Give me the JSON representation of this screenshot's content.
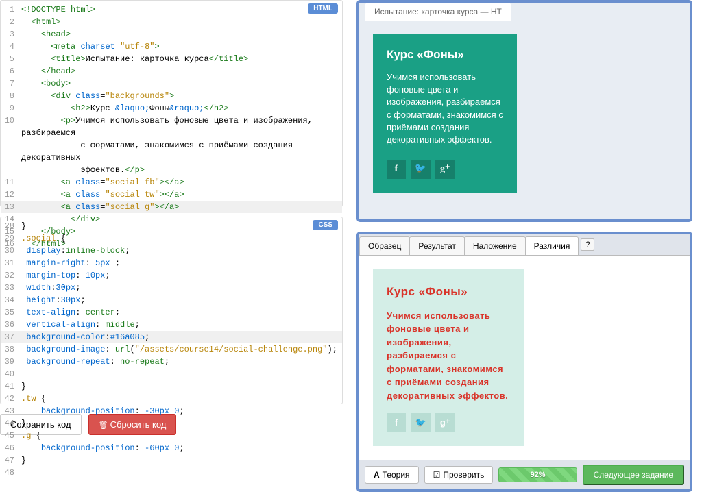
{
  "badges": {
    "html": "HTML",
    "css": "CSS"
  },
  "html_lines": [
    {
      "n": 1,
      "html": "<span class='tag'>&lt;!DOCTYPE html&gt;</span>"
    },
    {
      "n": 2,
      "html": "  <span class='tag'>&lt;html&gt;</span>"
    },
    {
      "n": 3,
      "html": "    <span class='tag'>&lt;head&gt;</span>"
    },
    {
      "n": 4,
      "html": "      <span class='tag'>&lt;meta</span> <span class='attr-name'>charset</span>=<span class='attr-val'>\"utf-8\"</span><span class='tag'>&gt;</span>"
    },
    {
      "n": 5,
      "html": "      <span class='tag'>&lt;title&gt;</span>Испытание: карточка курса<span class='tag'>&lt;/title&gt;</span>"
    },
    {
      "n": 6,
      "html": "    <span class='tag'>&lt;/head&gt;</span>"
    },
    {
      "n": 7,
      "html": "    <span class='tag'>&lt;body&gt;</span>"
    },
    {
      "n": 8,
      "html": "      <span class='tag'>&lt;div</span> <span class='attr-name'>class</span>=<span class='attr-val'>\"backgrounds\"</span><span class='tag'>&gt;</span>"
    },
    {
      "n": 9,
      "html": "          <span class='tag'>&lt;h2&gt;</span>Курс <span class='attr-name'>&amp;laquo;</span>Фоны<span class='attr-name'>&amp;raquo;</span><span class='tag'>&lt;/h2&gt;</span>"
    },
    {
      "n": 10,
      "html": "        <span class='tag'>&lt;p&gt;</span>Учимся использовать фоновые цвета и изображения, разбираемся\n            с форматами, знакомимся с приёмами создания декоративных\n            эффектов.<span class='tag'>&lt;/p&gt;</span>",
      "wrap": true
    },
    {
      "n": 11,
      "html": "        <span class='tag'>&lt;a</span> <span class='attr-name'>class</span>=<span class='attr-val'>\"social fb\"</span><span class='tag'>&gt;&lt;/a&gt;</span>"
    },
    {
      "n": 12,
      "html": "        <span class='tag'>&lt;a</span> <span class='attr-name'>class</span>=<span class='attr-val'>\"social tw\"</span><span class='tag'>&gt;&lt;/a&gt;</span>"
    },
    {
      "n": 13,
      "html": "        <span class='tag'>&lt;a</span> <span class='attr-name'>class</span>=<span class='attr-val'>\"social g\"</span><span class='tag'>&gt;&lt;/a&gt;</span>",
      "hl": true
    },
    {
      "n": 14,
      "html": "          <span class='tag'>&lt;/div&gt;</span>"
    },
    {
      "n": 15,
      "html": "    <span class='tag'>&lt;/body&gt;</span>"
    },
    {
      "n": 16,
      "html": "  <span class='tag'>&lt;/html&gt;</span>"
    }
  ],
  "css_lines": [
    {
      "n": 28,
      "html": "}"
    },
    {
      "n": 29,
      "html": "<span class='css-sel'>.social</span> {"
    },
    {
      "n": 30,
      "html": " <span class='css-prop'>display</span>:<span class='css-val'>inline-block</span>;"
    },
    {
      "n": 31,
      "html": " <span class='css-prop'>margin-right</span>: <span class='css-num'>5px</span> ;"
    },
    {
      "n": 32,
      "html": " <span class='css-prop'>margin-top</span>: <span class='css-num'>10px</span>;"
    },
    {
      "n": 33,
      "html": " <span class='css-prop'>width</span>:<span class='css-num'>30px</span>;"
    },
    {
      "n": 34,
      "html": " <span class='css-prop'>height</span>:<span class='css-num'>30px</span>;"
    },
    {
      "n": 35,
      "html": " <span class='css-prop'>text-align</span>: <span class='css-val'>center</span>;"
    },
    {
      "n": 36,
      "html": " <span class='css-prop'>vertical-align</span>: <span class='css-val'>middle</span>;"
    },
    {
      "n": 37,
      "html": " <span class='css-prop'>background-color</span>:<span class='css-num'>#16a085</span>;",
      "hl": true
    },
    {
      "n": 38,
      "html": " <span class='css-prop'>background-image</span>: <span class='css-val'>url</span>(<span class='css-str'>\"/assets/course14/social-challenge.png\"</span>);"
    },
    {
      "n": 39,
      "html": " <span class='css-prop'>background-repeat</span>: <span class='css-val'>no-repeat</span>;"
    },
    {
      "n": 40,
      "html": ""
    },
    {
      "n": 41,
      "html": "}"
    },
    {
      "n": 42,
      "html": "<span class='css-sel'>.tw</span> {"
    },
    {
      "n": 43,
      "html": "    <span class='css-prop'>background-position</span>: <span class='css-num'>-30px 0</span>;"
    },
    {
      "n": 44,
      "html": "}"
    },
    {
      "n": 45,
      "html": "<span class='css-sel'>.g</span> {"
    },
    {
      "n": 46,
      "html": "    <span class='css-prop'>background-position</span>: <span class='css-num'>-60px 0</span>;"
    },
    {
      "n": 47,
      "html": "}"
    },
    {
      "n": 48,
      "html": ""
    }
  ],
  "buttons": {
    "save": "Сохранить код",
    "reset": "Сбросить код"
  },
  "preview": {
    "tab": "Испытание: карточка курса — HT",
    "card_title": "Курс «Фоны»",
    "card_text": "Учимся использовать фоновые цвета и изображения, разбираемся с форматами, знакомимся с приёмами создания декоративных эффектов.",
    "icons": {
      "fb": "f",
      "tw": "🐦",
      "g": "g⁺"
    }
  },
  "diff": {
    "tabs": [
      "Образец",
      "Результат",
      "Наложение",
      "Различия"
    ],
    "active_tab": 3,
    "help": "?",
    "title": "Курс «Фоны»",
    "text": "Учимся использовать фоновые цвета и изображения, разбираемся с форматами, знакомимся с приёмами создания декоративных эффектов."
  },
  "bottom": {
    "theory": "Теория",
    "check": "Проверить",
    "progress": "92%",
    "next": "Следующее задание"
  }
}
